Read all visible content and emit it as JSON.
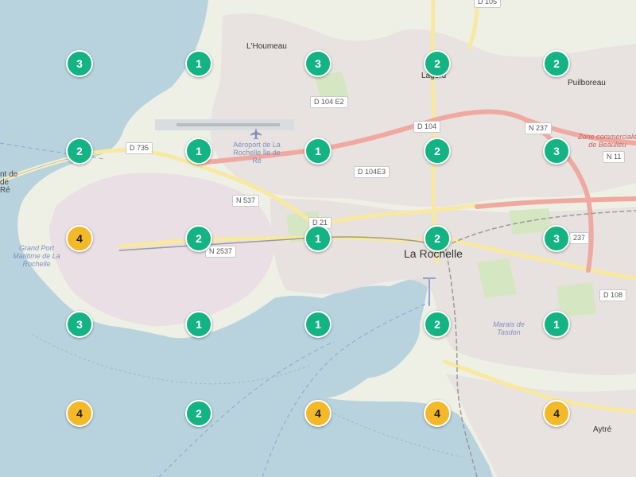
{
  "colors": {
    "sea": "#b8d3de",
    "land": "#eef0e6",
    "urban": "#e6e0de",
    "port": "#e9dfe5",
    "major_road": "#efa9a0",
    "secondary_road": "#f8e8a0",
    "cluster_green": "#14b383",
    "cluster_yellow": "#f4b928"
  },
  "map": {
    "labels": {
      "houmeau": "L'Houmeau",
      "lagord": "Lagord",
      "puilboreau": "Puilboreau",
      "la_rochelle": "La Rochelle",
      "aytre": "Aytré",
      "airport": "Aéroport de La Rochelle Île de Ré",
      "zone_commerciale": "Zone commerciale de Beaulieu",
      "grand_port": "Grand Port Maritime de La Rochelle",
      "marais": "Marais de Tasdon",
      "pont_ile_de_re": "nt de de Ré"
    },
    "roads": {
      "d105": "D 105",
      "d104e2": "D 104 E2",
      "d104": "D 104",
      "n237_top": "N 237",
      "d735": "D 735",
      "n11": "N 11",
      "d104e3": "D 104E3",
      "n537": "N 537",
      "d21": "D 21",
      "n2537": "N 2537",
      "n237_mid": "237",
      "d108": "D 108"
    }
  },
  "clusters": [
    {
      "count": "3",
      "color": "green"
    },
    {
      "count": "1",
      "color": "green"
    },
    {
      "count": "3",
      "color": "green"
    },
    {
      "count": "2",
      "color": "green"
    },
    {
      "count": "2",
      "color": "green"
    },
    {
      "count": "2",
      "color": "green"
    },
    {
      "count": "1",
      "color": "green"
    },
    {
      "count": "1",
      "color": "green"
    },
    {
      "count": "2",
      "color": "green"
    },
    {
      "count": "3",
      "color": "green"
    },
    {
      "count": "4",
      "color": "yellow"
    },
    {
      "count": "2",
      "color": "green"
    },
    {
      "count": "1",
      "color": "green"
    },
    {
      "count": "2",
      "color": "green"
    },
    {
      "count": "3",
      "color": "green"
    },
    {
      "count": "3",
      "color": "green"
    },
    {
      "count": "1",
      "color": "green"
    },
    {
      "count": "1",
      "color": "green"
    },
    {
      "count": "2",
      "color": "green"
    },
    {
      "count": "1",
      "color": "green"
    },
    {
      "count": "4",
      "color": "yellow"
    },
    {
      "count": "2",
      "color": "green"
    },
    {
      "count": "4",
      "color": "yellow"
    },
    {
      "count": "4",
      "color": "yellow"
    },
    {
      "count": "4",
      "color": "yellow"
    }
  ]
}
